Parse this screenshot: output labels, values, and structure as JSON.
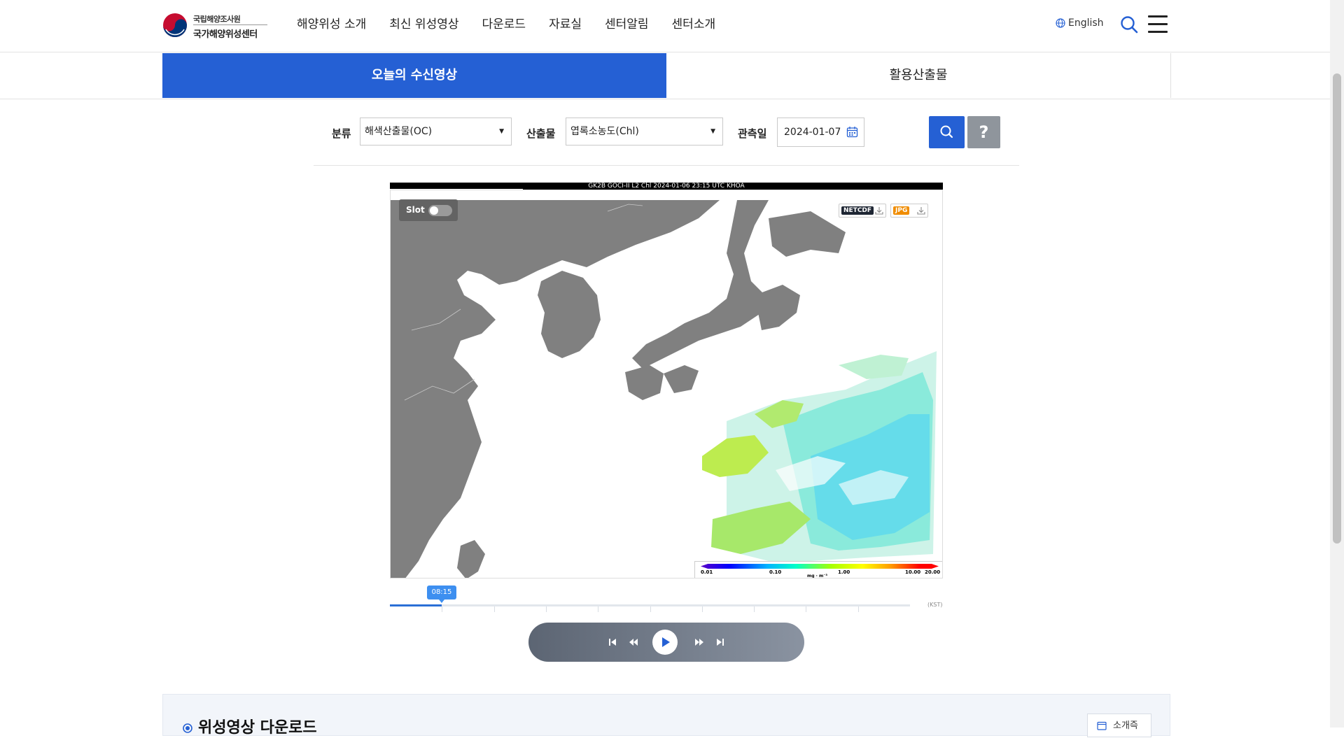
{
  "header": {
    "logo_line1": "국립해양조사원",
    "logo_line2": "국가해양위성센터",
    "nav": [
      "해양위성 소개",
      "최신 위성영상",
      "다운로드",
      "자료실",
      "센터알림",
      "센터소개"
    ],
    "lang": "English"
  },
  "tabs": {
    "active": "오늘의 수신영상",
    "inactive": "활용산출물"
  },
  "filters": {
    "category_label": "분류",
    "category_value": "해색산출물(OC)",
    "product_label": "산출물",
    "product_value": "엽록소농도(Chl)",
    "date_label": "관측일",
    "date_value": "2024-01-07",
    "help_label": "?"
  },
  "viewer": {
    "image_title": "GK2B GOCI-II L2 Chl 2024-01-06 23:15 UTC KHOA",
    "slot_label": "Slot",
    "slot_enabled": false,
    "downloads": [
      "NETCDF",
      "JPG"
    ],
    "colorbar": {
      "ticks": [
        "0.01",
        "0.10",
        "1.00",
        "10.00",
        "20.00"
      ],
      "unit": "mg · m⁻³"
    },
    "colors": {
      "land": "#808080",
      "netcdf": "#1e2633",
      "jpg": "#f08c00",
      "accent": "#2560d4"
    }
  },
  "timeline": {
    "current_time": "08:15",
    "timezone": "(KST)",
    "progress": 0.1
  },
  "player": {
    "buttons": [
      "skip-to-start-icon",
      "rewind-icon",
      "play-icon",
      "fast-forward-icon",
      "skip-to-end-icon"
    ]
  },
  "bottom": {
    "title": "위성영상 다운로드",
    "button": "소개즉"
  }
}
